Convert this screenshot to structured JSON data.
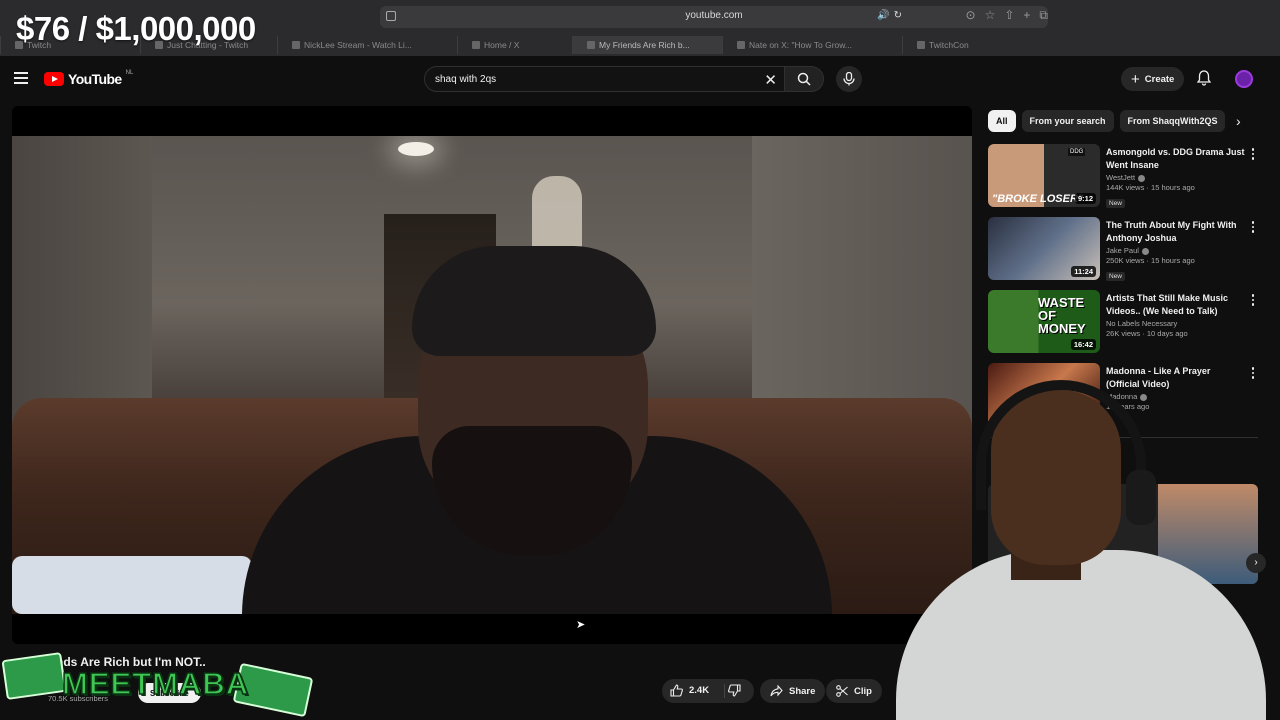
{
  "overlay": {
    "money": "$76 / $1,000,000"
  },
  "browser": {
    "url": "youtube.com",
    "tabs": [
      {
        "label": "Twitch",
        "active": false
      },
      {
        "label": "Just Chatting - Twitch",
        "active": false
      },
      {
        "label": "NickLee Stream - Watch Li...",
        "active": false
      },
      {
        "label": "Home / X",
        "active": false
      },
      {
        "label": "My Friends Are Rich b...",
        "active": true
      },
      {
        "label": "Nate on X: \"How To Grow...",
        "active": false
      },
      {
        "label": "TwitchCon",
        "active": false
      }
    ]
  },
  "youtube": {
    "logo": "YouTube",
    "region": "NL",
    "search": {
      "query": "shaq with 2qs"
    },
    "create_label": "Create"
  },
  "video": {
    "title": "My Friends Are Rich but I'm NOT..",
    "title_visible": "...nds Are Rich but I'm NOT..",
    "subscribers": "70.5K subscribers",
    "subscribe_label": "Subscribe",
    "likes": "2.4K",
    "share_label": "Share",
    "clip_label": "Clip"
  },
  "watermark": {
    "text": "MEETMABA"
  },
  "sidebar": {
    "chips": [
      {
        "label": "All",
        "active": true
      },
      {
        "label": "From your search",
        "active": false
      },
      {
        "label": "From ShaqqWith2QS",
        "active": false
      }
    ],
    "recommendations": [
      {
        "title": "Asmongold vs. DDG Drama Just Went Insane",
        "channel": "WestJett",
        "views": "144K views · 15 hours ago",
        "badge": "New",
        "duration": "9:12",
        "thumb_text": "\"BROKE LOSER\"",
        "thumb_tag": "DDG"
      },
      {
        "title": "The Truth About My Fight With Anthony Joshua",
        "channel": "Jake Paul",
        "views": "250K views · 15 hours ago",
        "badge": "New",
        "duration": "11:24"
      },
      {
        "title": "Artists That Still Make Music Videos.. (We Need to Talk)",
        "channel": "No Labels Necessary",
        "views": "26K views · 10 days ago",
        "badge": "",
        "duration": "16:42",
        "thumb_text": "WASTE OF MONEY"
      },
      {
        "title": "Madonna - Like A Prayer (Official Video)",
        "channel": "Madonna",
        "views": "16 years ago",
        "badge": "",
        "duration": ""
      }
    ]
  }
}
